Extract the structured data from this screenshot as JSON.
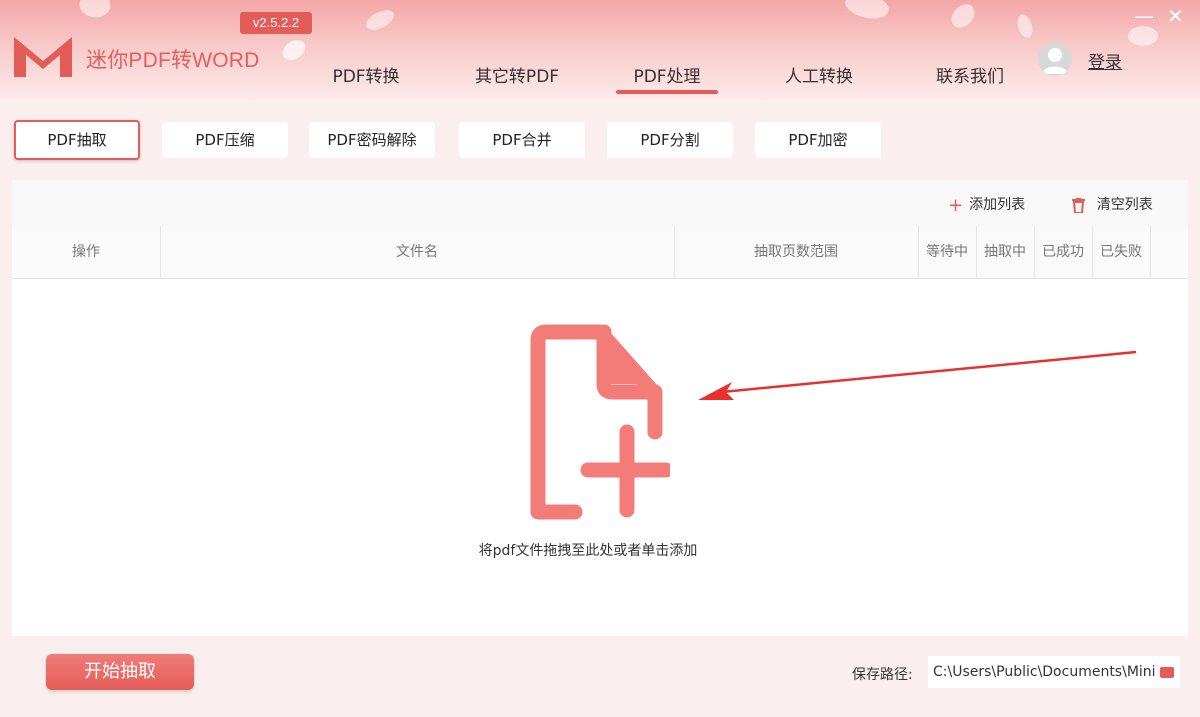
{
  "app": {
    "title": "迷你PDF转WORD",
    "version": "v2.5.2.2",
    "login_label": "登录",
    "accent_color": "#e45c58"
  },
  "nav": {
    "items": [
      {
        "label": "PDF转换"
      },
      {
        "label": "其它转PDF"
      },
      {
        "label": "PDF处理",
        "active": true
      },
      {
        "label": "人工转换"
      },
      {
        "label": "联系我们"
      }
    ]
  },
  "window_controls": {
    "minimize": "—",
    "close": "✕"
  },
  "subtabs": {
    "items": [
      {
        "label": "PDF抽取",
        "active": true
      },
      {
        "label": "PDF压缩"
      },
      {
        "label": "PDF密码解除"
      },
      {
        "label": "PDF合并"
      },
      {
        "label": "PDF分割"
      },
      {
        "label": "PDF加密"
      }
    ]
  },
  "toolbar": {
    "add_list_label": "添加列表",
    "clear_list_label": "清空列表"
  },
  "table": {
    "columns": [
      "操作",
      "文件名",
      "抽取页数范围",
      "等待中",
      "抽取中",
      "已成功",
      "已失败"
    ]
  },
  "drop_zone": {
    "hint": "将pdf文件拖拽至此处或者单击添加",
    "icon": "file-add-icon"
  },
  "footer": {
    "start_label": "开始抽取",
    "save_path_label": "保存路径:",
    "save_path_value": "C:\\Users\\Public\\Documents\\Mini"
  }
}
